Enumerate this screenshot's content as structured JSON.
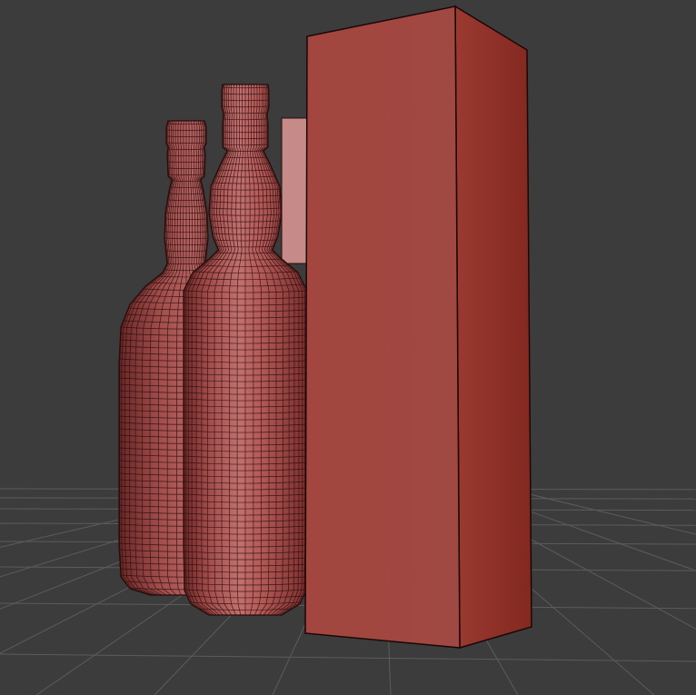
{
  "viewport": {
    "background_color": "#3c3c3c",
    "grid_color": "#5c5c5c",
    "mesh_base_color": "#b05452",
    "mesh_shadow_color": "#7e2f2c",
    "mesh_highlight_color": "#c87b7a",
    "wire_color": "#2a0d0c",
    "box_front_color": "#9c413a",
    "box_side_color": "#8d2f26",
    "back_panel_color": "#c68c8a",
    "objects": [
      {
        "kind": "bottle",
        "name": "bottle-back",
        "icon": "bottle-wireframe"
      },
      {
        "kind": "bottle",
        "name": "bottle-front",
        "icon": "bottle-wireframe"
      },
      {
        "kind": "box",
        "name": "gift-box",
        "icon": "box-mesh"
      },
      {
        "kind": "panel",
        "name": "back-panel",
        "icon": "plane-mesh"
      }
    ]
  }
}
